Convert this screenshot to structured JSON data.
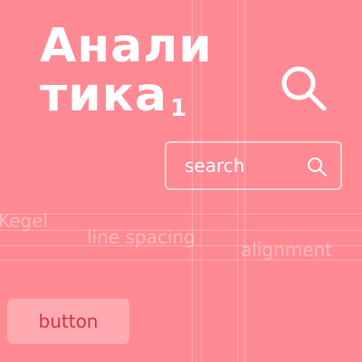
{
  "title": {
    "line1": "Анали",
    "line2": "тика",
    "subscript": "1"
  },
  "icons": {
    "header_search": "search-icon",
    "field_search": "search-icon"
  },
  "search": {
    "placeholder": "search"
  },
  "labels": {
    "kegel": "Kegel",
    "line_spacing": "line spacing",
    "alignment": "alignment"
  },
  "button": {
    "label": "button"
  },
  "colors": {
    "background": "#ff8a93",
    "text": "#ffffff",
    "button_text": "#d0334a"
  }
}
